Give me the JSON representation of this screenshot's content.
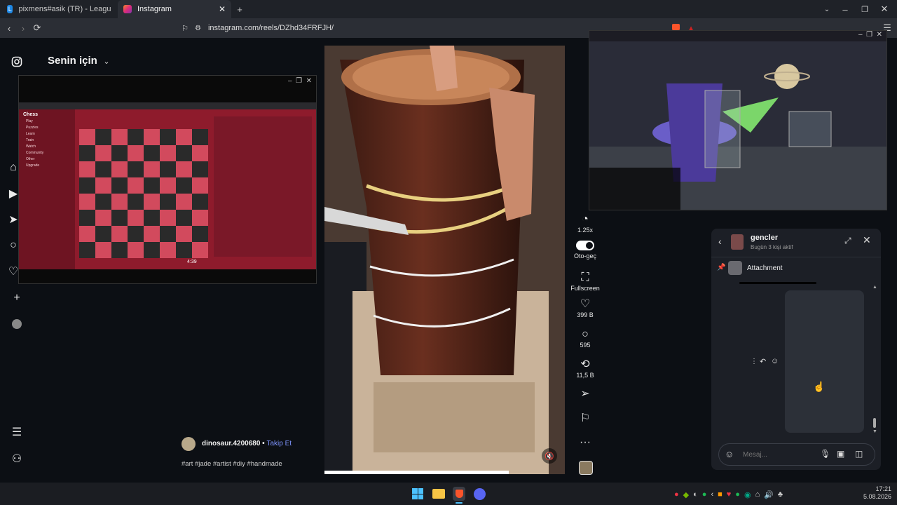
{
  "browser": {
    "tabs": [
      {
        "label": "pixmens#asik (TR) - LeagueOfGraphs",
        "fav_letter": "L",
        "fav_color": "#1e88e5"
      },
      {
        "label": "Instagram",
        "fav_color": "#e1306c"
      }
    ],
    "new_tab": "+",
    "url": "instagram.com/reels/DZhd34FRFJH/"
  },
  "instagram": {
    "feed_title": "Senin için",
    "post": {
      "username": "dinosaur.4200680",
      "separator": "•",
      "follow_label": "Takip Et",
      "caption": "#art #jade #artist #diy #handmade"
    },
    "actions": {
      "speed": "1.25x",
      "autoplay": "Oto-geç",
      "fullscreen": "Fullscreen",
      "likes": "399 B",
      "comments": "595",
      "shares": "11,5 B"
    }
  },
  "chat": {
    "group_name": "gencler",
    "status": "Bugün 3 kişi aktif",
    "pinned": "Attachment",
    "input_placeholder": "Mesaj..."
  },
  "chess": {
    "site": "Chess",
    "menu": [
      "Play",
      "Puzzles",
      "Learn",
      "Train",
      "Watch",
      "Community",
      "Other",
      "Upgrade"
    ],
    "timer": "4:39"
  },
  "taskbar": {
    "time": "17:21",
    "date": "5.08.2026"
  },
  "colors": {
    "accent_link": "#7f95ff",
    "chess_red": "#b0243a",
    "board_light": "#d24a5d",
    "board_dark": "#2a2a2a"
  }
}
